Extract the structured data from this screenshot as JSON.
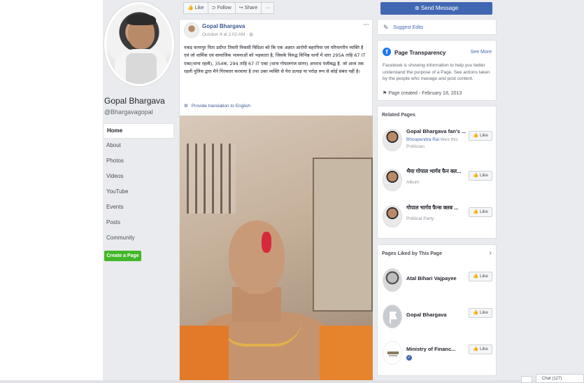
{
  "profile": {
    "name": "Gopal Bhargava",
    "handle": "@Bhargavagopal"
  },
  "nav": {
    "items": [
      "Home",
      "About",
      "Photos",
      "Videos",
      "YouTube",
      "Events",
      "Posts",
      "Community"
    ],
    "create_label": "Create a Page"
  },
  "actions": {
    "like": "Like",
    "follow": "Follow",
    "share": "Share",
    "more": "···",
    "send_message": "Send Message"
  },
  "post": {
    "author": "Gopal Bhargava",
    "time": "October 4 at 2:02 AM ·",
    "more": "···",
    "text": "पकड़ वानरपुर पिता प्रदीप्त तिवारी निवासी विदिशा को कि एक अज्ञात आरोपी बहरपिया एवं परिनागरीय व्यक्ति है एवं जो धार्मिक एवं सामाजिक भावनाओं को भड़काता है, जिसके विरुद्ध विभिन्न थानों में धारा 295A ताहि 67 IT एक्ट(थाना रहली), 354क, 294 ताहि 67 IT एक्ट (थाना गोपालगंज सागर) अपराध पंजीबद्ध है. जो आज तक रहली पुलिस द्वारा मैने गिरफ्तार करवाया है तथा उक्त व्यक्ति से मेरा प्रत्यक्ष या परोक्ष रूप से कोई संबंध नहीं है।",
    "translate": "Provide translation to English"
  },
  "sidebar": {
    "suggest_edits": "Suggest Edits",
    "transparency": {
      "title": "Page Transparency",
      "see_more": "See More",
      "desc": "Facebook is showing information to help you better understand the purpose of a Page. See actions taken by the people who manage and post content.",
      "created": "Page created - February 18, 2013"
    },
    "related": {
      "title": "Related Pages",
      "pages": [
        {
          "name": "Gopal Bhargava fan's ...",
          "liker": "Bhoopendra Rai",
          "sub": "likes this",
          "category": "Politician",
          "like": "Like"
        },
        {
          "name": "भैया गोपाल भार्गव फैन क्ल...",
          "liker": "",
          "sub": "",
          "category": "Album",
          "like": "Like"
        },
        {
          "name": "गोपाल भार्गव फैन्स क्लब ...",
          "liker": "",
          "sub": "",
          "category": "Political Party",
          "like": "Like"
        }
      ]
    },
    "liked": {
      "title": "Pages Liked by This Page",
      "pages": [
        {
          "name": "Atal Bihari Vajpayee",
          "like": "Like"
        },
        {
          "name": "Gopal Bhargava",
          "like": "Like"
        },
        {
          "name": "Ministry of Financ...",
          "like": "Like"
        }
      ]
    }
  },
  "chat": {
    "label": "Chat (127)"
  }
}
